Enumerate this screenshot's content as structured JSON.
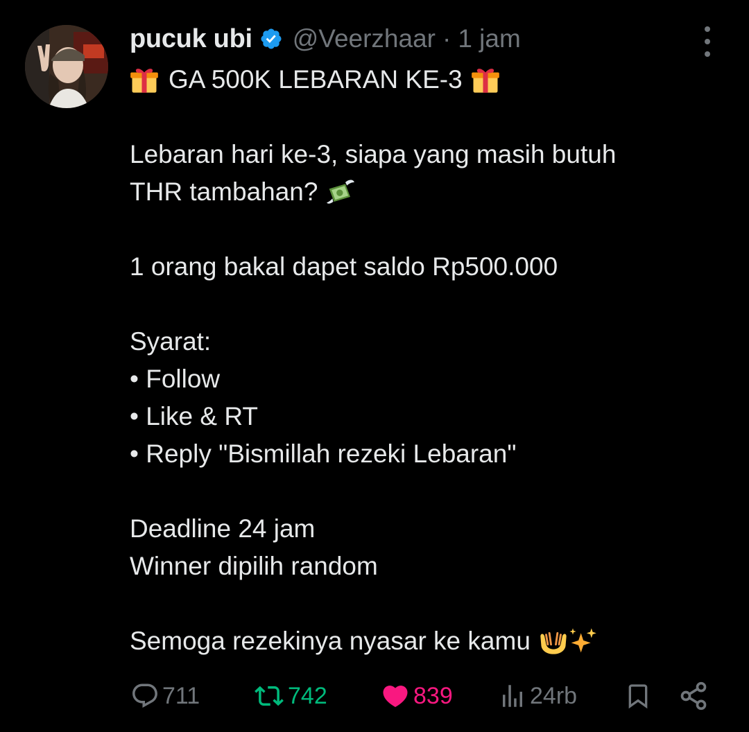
{
  "author": {
    "display_name": "pucuk ubi",
    "handle": "@Veerzhaar",
    "separator": "·",
    "time": "1 jam",
    "verified": true
  },
  "post": {
    "headline": "GA 500K LEBARAN KE-3",
    "lines": [
      "Lebaran hari ke-3, siapa yang masih butuh",
      "THR tambahan?",
      "1 orang bakal dapet saldo Rp500.000",
      "Syarat:",
      "• Follow",
      "• Like & RT",
      "• Reply \"Bismillah rezeki Lebaran\"",
      "Deadline 24 jam",
      "Winner dipilih random",
      "Semoga rezekinya nyasar ke kamu"
    ],
    "emojis": {
      "headline_left": "gift-emoji",
      "headline_right": "gift-emoji",
      "thr": "money-with-wings-emoji",
      "closing_1": "palms-up-together-emoji",
      "closing_2": "sparkles-emoji"
    }
  },
  "actions": {
    "replies": "711",
    "retweets": "742",
    "likes": "839",
    "views": "24rb"
  },
  "colors": {
    "background": "#000000",
    "text": "#e7e9ea",
    "muted": "#71767b",
    "verified": "#1d9bf0",
    "retweet": "#00ba7c",
    "like": "#f91880"
  }
}
